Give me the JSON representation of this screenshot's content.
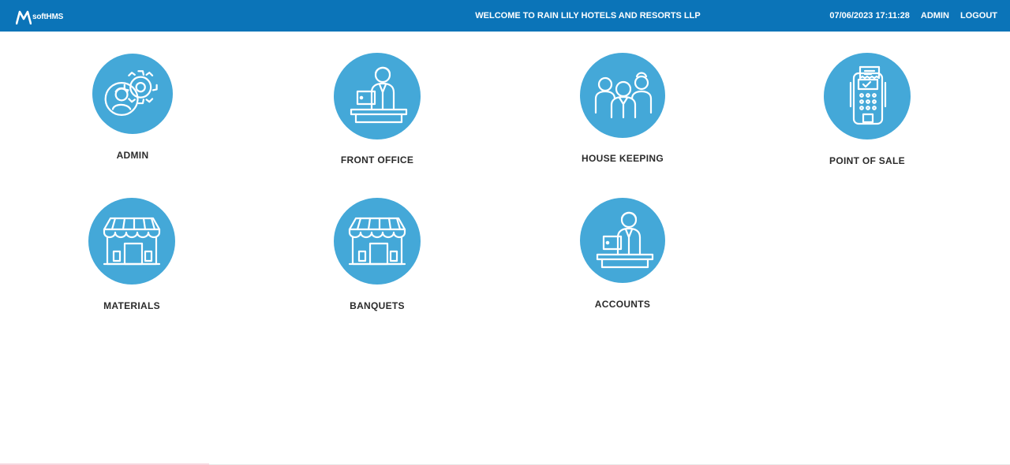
{
  "header": {
    "logo_text": "softHMS",
    "welcome": "WELCOME TO RAIN LILY HOTELS AND RESORTS LLP",
    "datetime": "07/06/2023 17:11:28",
    "user": "ADMIN",
    "logout_label": "LOGOUT",
    "bar_color": "#0b74b8"
  },
  "modules": [
    {
      "label": "ADMIN",
      "icon": "admin-gear-person-icon"
    },
    {
      "label": "FRONT OFFICE",
      "icon": "receptionist-desk-icon"
    },
    {
      "label": "HOUSE KEEPING",
      "icon": "staff-group-icon"
    },
    {
      "label": "POINT OF SALE",
      "icon": "card-terminal-icon"
    },
    {
      "label": "MATERIALS",
      "icon": "store-icon"
    },
    {
      "label": "BANQUETS",
      "icon": "store-icon"
    },
    {
      "label": "ACCOUNTS",
      "icon": "desk-clerk-icon"
    }
  ],
  "colors": {
    "circle": "#44a8d8",
    "label_text": "#2b2b2b"
  }
}
